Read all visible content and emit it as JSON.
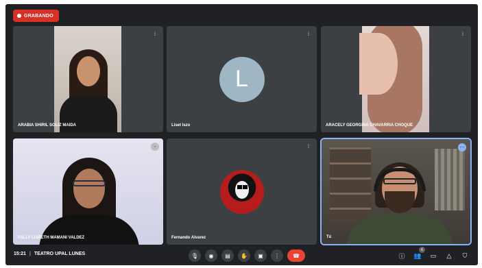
{
  "recording": {
    "label": "GRABANDO"
  },
  "participants": [
    {
      "name": "ARABIA SHIRIL SOLIZ MAIDA",
      "type": "video"
    },
    {
      "name": "Liset Iszo",
      "type": "avatar",
      "initial": "L"
    },
    {
      "name": "ARACELY GEORGINA CHAVARRIA CHOQUE",
      "type": "video"
    },
    {
      "name": "FALLY LISBETH MAMANI VALDEZ",
      "type": "video"
    },
    {
      "name": "Fernando Alvarez",
      "type": "avatar-image"
    },
    {
      "name": "Tú",
      "type": "video"
    }
  ],
  "meeting": {
    "time": "15:21",
    "title": "TEATRO UPAL LUNES"
  },
  "controls": [
    {
      "icon": "mic-icon",
      "glyph": "🎙"
    },
    {
      "icon": "camera-icon",
      "glyph": "◉"
    },
    {
      "icon": "captions-icon",
      "glyph": "▤"
    },
    {
      "icon": "raise-hand-icon",
      "glyph": "✋"
    },
    {
      "icon": "present-icon",
      "glyph": "▣"
    },
    {
      "icon": "more-options-icon",
      "glyph": "⋮"
    },
    {
      "icon": "leave-call-icon",
      "glyph": "☎"
    }
  ],
  "right_controls": [
    {
      "icon": "info-icon",
      "glyph": "ⓘ"
    },
    {
      "icon": "people-icon",
      "glyph": "👥",
      "badge": "6"
    },
    {
      "icon": "chat-icon",
      "glyph": "▭"
    },
    {
      "icon": "activities-icon",
      "glyph": "△"
    },
    {
      "icon": "host-controls-icon",
      "glyph": "⛉"
    }
  ],
  "colors": {
    "background": "#202124",
    "tile": "#3c4043",
    "record": "#d93025",
    "end_call": "#ea4335",
    "active_border": "#8ab4f8"
  }
}
